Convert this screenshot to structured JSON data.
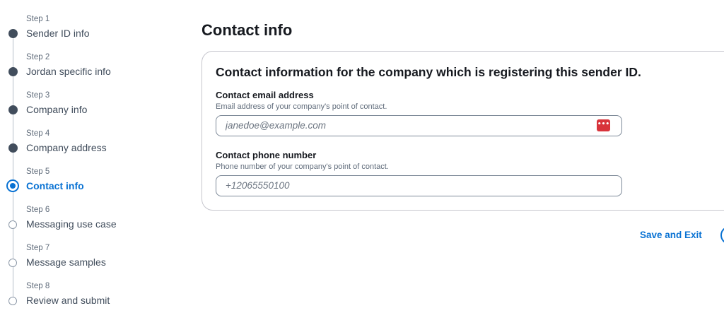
{
  "stepper": {
    "steps": [
      {
        "label": "Step 1",
        "title": "Sender ID info",
        "status": "done"
      },
      {
        "label": "Step 2",
        "title": "Jordan specific info",
        "status": "done"
      },
      {
        "label": "Step 3",
        "title": "Company info",
        "status": "done"
      },
      {
        "label": "Step 4",
        "title": "Company address",
        "status": "done"
      },
      {
        "label": "Step 5",
        "title": "Contact info",
        "status": "active"
      },
      {
        "label": "Step 6",
        "title": "Messaging use case",
        "status": "todo"
      },
      {
        "label": "Step 7",
        "title": "Message samples",
        "status": "todo"
      },
      {
        "label": "Step 8",
        "title": "Review and submit",
        "status": "todo"
      }
    ]
  },
  "main": {
    "title": "Contact info",
    "container": {
      "header": "Contact information for the company which is registering this sender ID.",
      "email": {
        "label": "Contact email address",
        "description": "Email address of your company's point of contact.",
        "placeholder": "janedoe@example.com",
        "value": "",
        "autofill_icon": "password-manager-icon"
      },
      "phone": {
        "label": "Contact phone number",
        "description": "Phone number of your company's point of contact.",
        "placeholder": "+12065550100",
        "value": ""
      }
    },
    "actions": {
      "save_exit_label": "Save and Exit"
    }
  },
  "colors": {
    "accent": "#0972d3",
    "done_dot": "#414d5c",
    "pw_icon": "#d8333b"
  }
}
